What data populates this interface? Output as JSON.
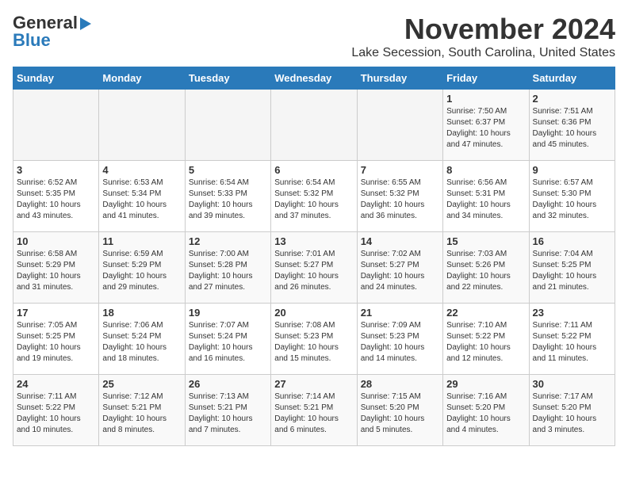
{
  "logo": {
    "line1": "General",
    "line2": "Blue",
    "arrow": "▶"
  },
  "title": "November 2024",
  "location": "Lake Secession, South Carolina, United States",
  "headers": [
    "Sunday",
    "Monday",
    "Tuesday",
    "Wednesday",
    "Thursday",
    "Friday",
    "Saturday"
  ],
  "weeks": [
    [
      {
        "day": "",
        "info": ""
      },
      {
        "day": "",
        "info": ""
      },
      {
        "day": "",
        "info": ""
      },
      {
        "day": "",
        "info": ""
      },
      {
        "day": "",
        "info": ""
      },
      {
        "day": "1",
        "info": "Sunrise: 7:50 AM\nSunset: 6:37 PM\nDaylight: 10 hours\nand 47 minutes."
      },
      {
        "day": "2",
        "info": "Sunrise: 7:51 AM\nSunset: 6:36 PM\nDaylight: 10 hours\nand 45 minutes."
      }
    ],
    [
      {
        "day": "3",
        "info": "Sunrise: 6:52 AM\nSunset: 5:35 PM\nDaylight: 10 hours\nand 43 minutes."
      },
      {
        "day": "4",
        "info": "Sunrise: 6:53 AM\nSunset: 5:34 PM\nDaylight: 10 hours\nand 41 minutes."
      },
      {
        "day": "5",
        "info": "Sunrise: 6:54 AM\nSunset: 5:33 PM\nDaylight: 10 hours\nand 39 minutes."
      },
      {
        "day": "6",
        "info": "Sunrise: 6:54 AM\nSunset: 5:32 PM\nDaylight: 10 hours\nand 37 minutes."
      },
      {
        "day": "7",
        "info": "Sunrise: 6:55 AM\nSunset: 5:32 PM\nDaylight: 10 hours\nand 36 minutes."
      },
      {
        "day": "8",
        "info": "Sunrise: 6:56 AM\nSunset: 5:31 PM\nDaylight: 10 hours\nand 34 minutes."
      },
      {
        "day": "9",
        "info": "Sunrise: 6:57 AM\nSunset: 5:30 PM\nDaylight: 10 hours\nand 32 minutes."
      }
    ],
    [
      {
        "day": "10",
        "info": "Sunrise: 6:58 AM\nSunset: 5:29 PM\nDaylight: 10 hours\nand 31 minutes."
      },
      {
        "day": "11",
        "info": "Sunrise: 6:59 AM\nSunset: 5:29 PM\nDaylight: 10 hours\nand 29 minutes."
      },
      {
        "day": "12",
        "info": "Sunrise: 7:00 AM\nSunset: 5:28 PM\nDaylight: 10 hours\nand 27 minutes."
      },
      {
        "day": "13",
        "info": "Sunrise: 7:01 AM\nSunset: 5:27 PM\nDaylight: 10 hours\nand 26 minutes."
      },
      {
        "day": "14",
        "info": "Sunrise: 7:02 AM\nSunset: 5:27 PM\nDaylight: 10 hours\nand 24 minutes."
      },
      {
        "day": "15",
        "info": "Sunrise: 7:03 AM\nSunset: 5:26 PM\nDaylight: 10 hours\nand 22 minutes."
      },
      {
        "day": "16",
        "info": "Sunrise: 7:04 AM\nSunset: 5:25 PM\nDaylight: 10 hours\nand 21 minutes."
      }
    ],
    [
      {
        "day": "17",
        "info": "Sunrise: 7:05 AM\nSunset: 5:25 PM\nDaylight: 10 hours\nand 19 minutes."
      },
      {
        "day": "18",
        "info": "Sunrise: 7:06 AM\nSunset: 5:24 PM\nDaylight: 10 hours\nand 18 minutes."
      },
      {
        "day": "19",
        "info": "Sunrise: 7:07 AM\nSunset: 5:24 PM\nDaylight: 10 hours\nand 16 minutes."
      },
      {
        "day": "20",
        "info": "Sunrise: 7:08 AM\nSunset: 5:23 PM\nDaylight: 10 hours\nand 15 minutes."
      },
      {
        "day": "21",
        "info": "Sunrise: 7:09 AM\nSunset: 5:23 PM\nDaylight: 10 hours\nand 14 minutes."
      },
      {
        "day": "22",
        "info": "Sunrise: 7:10 AM\nSunset: 5:22 PM\nDaylight: 10 hours\nand 12 minutes."
      },
      {
        "day": "23",
        "info": "Sunrise: 7:11 AM\nSunset: 5:22 PM\nDaylight: 10 hours\nand 11 minutes."
      }
    ],
    [
      {
        "day": "24",
        "info": "Sunrise: 7:11 AM\nSunset: 5:22 PM\nDaylight: 10 hours\nand 10 minutes."
      },
      {
        "day": "25",
        "info": "Sunrise: 7:12 AM\nSunset: 5:21 PM\nDaylight: 10 hours\nand 8 minutes."
      },
      {
        "day": "26",
        "info": "Sunrise: 7:13 AM\nSunset: 5:21 PM\nDaylight: 10 hours\nand 7 minutes."
      },
      {
        "day": "27",
        "info": "Sunrise: 7:14 AM\nSunset: 5:21 PM\nDaylight: 10 hours\nand 6 minutes."
      },
      {
        "day": "28",
        "info": "Sunrise: 7:15 AM\nSunset: 5:20 PM\nDaylight: 10 hours\nand 5 minutes."
      },
      {
        "day": "29",
        "info": "Sunrise: 7:16 AM\nSunset: 5:20 PM\nDaylight: 10 hours\nand 4 minutes."
      },
      {
        "day": "30",
        "info": "Sunrise: 7:17 AM\nSunset: 5:20 PM\nDaylight: 10 hours\nand 3 minutes."
      }
    ]
  ]
}
